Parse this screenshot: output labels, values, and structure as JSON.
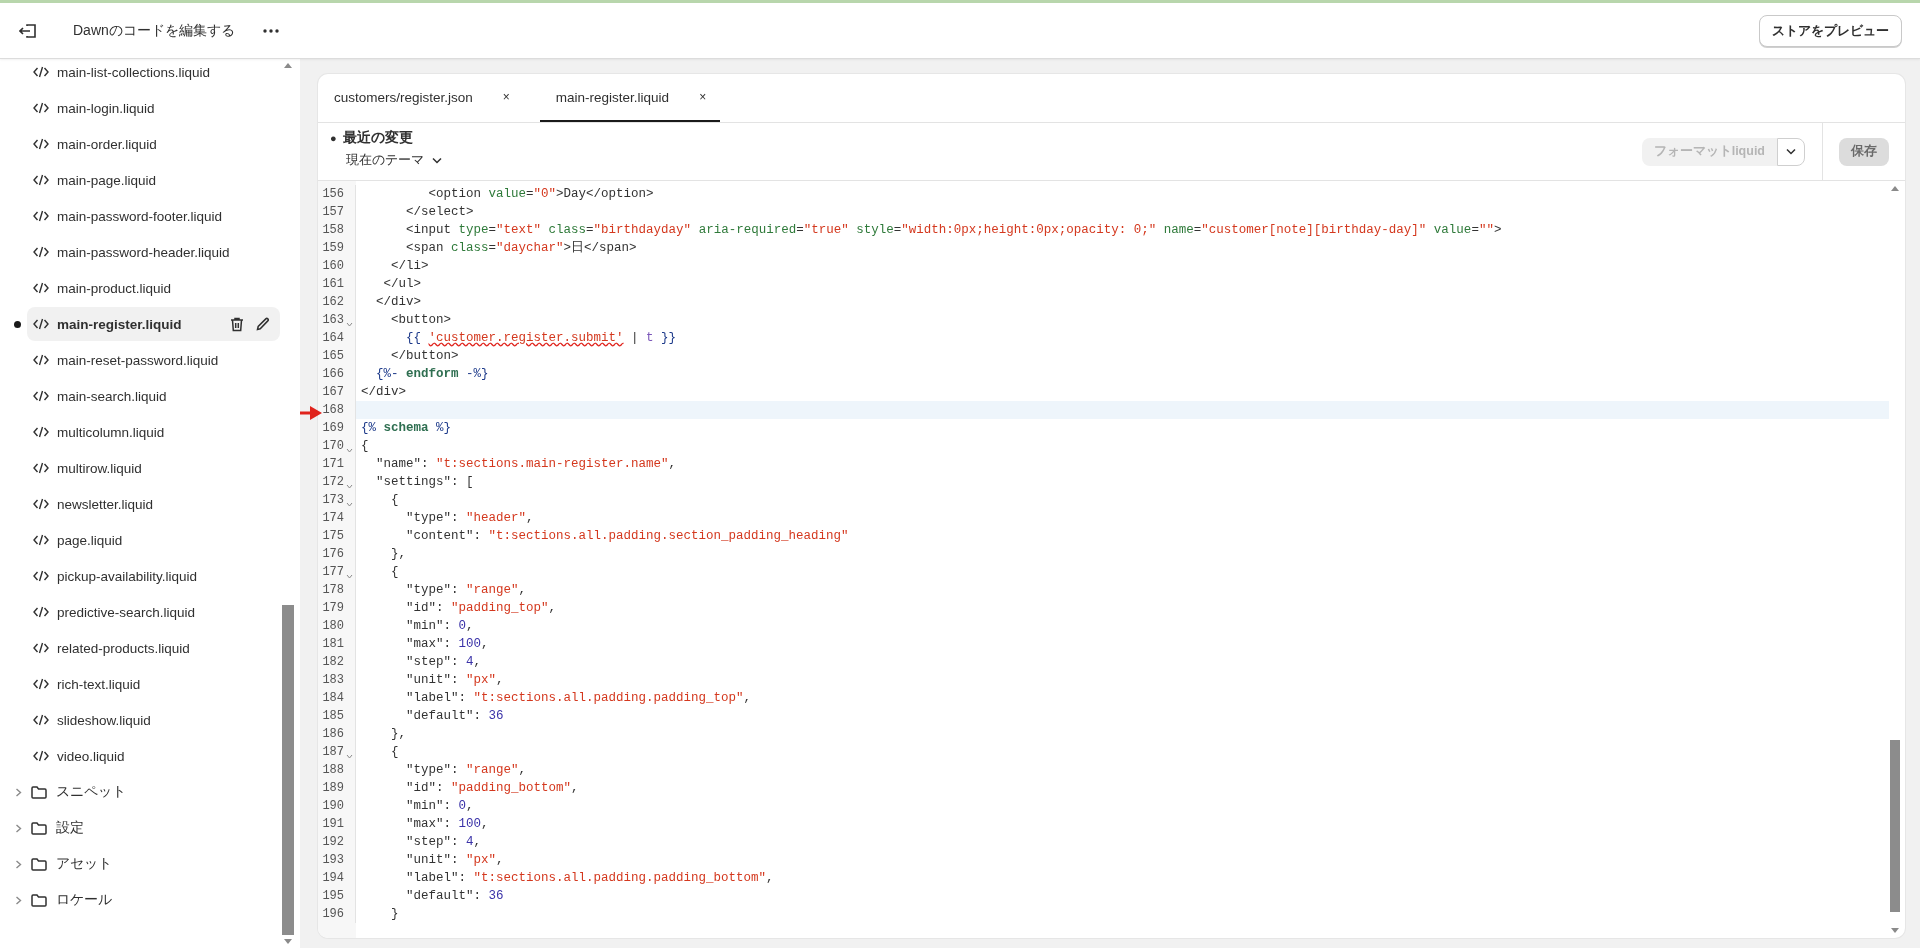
{
  "topbar": {
    "title": "Dawnのコードを編集する",
    "preview_button": "ストアをプレビュー"
  },
  "sidebar": {
    "files": [
      {
        "label": "main-list-collections.liquid",
        "selected": false,
        "modified": false
      },
      {
        "label": "main-login.liquid",
        "selected": false,
        "modified": false
      },
      {
        "label": "main-order.liquid",
        "selected": false,
        "modified": false
      },
      {
        "label": "main-page.liquid",
        "selected": false,
        "modified": false
      },
      {
        "label": "main-password-footer.liquid",
        "selected": false,
        "modified": false
      },
      {
        "label": "main-password-header.liquid",
        "selected": false,
        "modified": false
      },
      {
        "label": "main-product.liquid",
        "selected": false,
        "modified": false
      },
      {
        "label": "main-register.liquid",
        "selected": true,
        "modified": true
      },
      {
        "label": "main-reset-password.liquid",
        "selected": false,
        "modified": false
      },
      {
        "label": "main-search.liquid",
        "selected": false,
        "modified": false
      },
      {
        "label": "multicolumn.liquid",
        "selected": false,
        "modified": false
      },
      {
        "label": "multirow.liquid",
        "selected": false,
        "modified": false
      },
      {
        "label": "newsletter.liquid",
        "selected": false,
        "modified": false
      },
      {
        "label": "page.liquid",
        "selected": false,
        "modified": false
      },
      {
        "label": "pickup-availability.liquid",
        "selected": false,
        "modified": false
      },
      {
        "label": "predictive-search.liquid",
        "selected": false,
        "modified": false
      },
      {
        "label": "related-products.liquid",
        "selected": false,
        "modified": false
      },
      {
        "label": "rich-text.liquid",
        "selected": false,
        "modified": false
      },
      {
        "label": "slideshow.liquid",
        "selected": false,
        "modified": false
      },
      {
        "label": "video.liquid",
        "selected": false,
        "modified": false
      }
    ],
    "folders": [
      {
        "label": "スニペット",
        "expanded": false
      },
      {
        "label": "設定",
        "expanded": false
      },
      {
        "label": "アセット",
        "expanded": false
      },
      {
        "label": "ロケール",
        "expanded": false
      }
    ]
  },
  "editor": {
    "tabs": [
      {
        "label": "customers/register.json",
        "close": "×",
        "selected": false
      },
      {
        "label": "main-register.liquid",
        "close": "×",
        "selected": true
      }
    ],
    "recent_changes": {
      "dot": "●",
      "label": "最近の変更",
      "theme": "現在のテーマ"
    },
    "format_button": {
      "label": "フォーマットliquid",
      "disabled": true
    },
    "save_button": {
      "label": "保存",
      "disabled": true
    },
    "lines": [
      {
        "number": "156",
        "foldable": false,
        "current": false,
        "tokens": [
          {
            "kind": "plain",
            "text": "         <option "
          },
          {
            "kind": "attr",
            "text": "value"
          },
          {
            "kind": "plain",
            "text": "="
          },
          {
            "kind": "string",
            "text": "\"0\""
          },
          {
            "kind": "plain",
            "text": ">Day</option>"
          }
        ]
      },
      {
        "number": "157",
        "foldable": false,
        "current": false,
        "tokens": [
          {
            "kind": "plain",
            "text": "      </select>"
          }
        ]
      },
      {
        "number": "158",
        "foldable": false,
        "current": false,
        "tokens": [
          {
            "kind": "plain",
            "text": "      <input "
          },
          {
            "kind": "attr",
            "text": "type"
          },
          {
            "kind": "plain",
            "text": "="
          },
          {
            "kind": "string",
            "text": "\"text\""
          },
          {
            "kind": "attr",
            "text": " class"
          },
          {
            "kind": "plain",
            "text": "="
          },
          {
            "kind": "string",
            "text": "\"birthdayday\""
          },
          {
            "kind": "attr",
            "text": " aria-required"
          },
          {
            "kind": "plain",
            "text": "="
          },
          {
            "kind": "string",
            "text": "\"true\""
          },
          {
            "kind": "attr",
            "text": " style"
          },
          {
            "kind": "plain",
            "text": "="
          },
          {
            "kind": "string",
            "text": "\"width:0px;height:0px;opacity: 0;\""
          },
          {
            "kind": "attr",
            "text": " name"
          },
          {
            "kind": "plain",
            "text": "="
          },
          {
            "kind": "string",
            "text": "\"customer[note][birthday-day]\""
          },
          {
            "kind": "attr",
            "text": " value"
          },
          {
            "kind": "plain",
            "text": "="
          },
          {
            "kind": "string",
            "text": "\"\""
          },
          {
            "kind": "plain",
            "text": ">"
          }
        ]
      },
      {
        "number": "159",
        "foldable": false,
        "current": false,
        "tokens": [
          {
            "kind": "plain",
            "text": "      <span "
          },
          {
            "kind": "attr",
            "text": "class"
          },
          {
            "kind": "plain",
            "text": "="
          },
          {
            "kind": "string",
            "text": "\"daychar\""
          },
          {
            "kind": "plain",
            "text": ">日</span>"
          }
        ]
      },
      {
        "number": "160",
        "foldable": false,
        "current": false,
        "tokens": [
          {
            "kind": "plain",
            "text": "    </li>"
          }
        ]
      },
      {
        "number": "161",
        "foldable": false,
        "current": false,
        "tokens": [
          {
            "kind": "plain",
            "text": "   </ul>"
          }
        ]
      },
      {
        "number": "162",
        "foldable": false,
        "current": false,
        "tokens": [
          {
            "kind": "plain",
            "text": "  </div>"
          }
        ]
      },
      {
        "number": "163",
        "foldable": true,
        "current": false,
        "tokens": [
          {
            "kind": "plain",
            "text": "    <button>"
          }
        ]
      },
      {
        "number": "164",
        "foldable": false,
        "current": false,
        "tokens": [
          {
            "kind": "liquid",
            "text": "      {{ "
          },
          {
            "kind": "error",
            "text": "'customer.register.submit'"
          },
          {
            "kind": "plain",
            "text": " | "
          },
          {
            "kind": "filter",
            "text": "t"
          },
          {
            "kind": "liquid",
            "text": " }}"
          }
        ]
      },
      {
        "number": "165",
        "foldable": false,
        "current": false,
        "tokens": [
          {
            "kind": "plain",
            "text": "    </button>"
          }
        ]
      },
      {
        "number": "166",
        "foldable": false,
        "current": false,
        "tokens": [
          {
            "kind": "liquid",
            "text": "  {%- "
          },
          {
            "kind": "keyword",
            "text": "endform"
          },
          {
            "kind": "liquid",
            "text": " -%}"
          }
        ]
      },
      {
        "number": "167",
        "foldable": false,
        "current": false,
        "tokens": [
          {
            "kind": "plain",
            "text": "</div>"
          }
        ]
      },
      {
        "number": "168",
        "foldable": false,
        "current": true
      },
      {
        "number": "169",
        "foldable": false,
        "current": false,
        "tokens": [
          {
            "kind": "liquid",
            "text": "{% "
          },
          {
            "kind": "keyword",
            "text": "schema"
          },
          {
            "kind": "liquid",
            "text": " %}"
          }
        ]
      },
      {
        "number": "170",
        "foldable": true,
        "current": false,
        "tokens": [
          {
            "kind": "plain",
            "text": "{"
          }
        ]
      },
      {
        "number": "171",
        "foldable": false,
        "current": false,
        "tokens": [
          {
            "kind": "plain",
            "text": "  \"name\": "
          },
          {
            "kind": "string",
            "text": "\"t:sections.main-register.name\""
          },
          {
            "kind": "plain",
            "text": ","
          }
        ]
      },
      {
        "number": "172",
        "foldable": true,
        "current": false,
        "tokens": [
          {
            "kind": "plain",
            "text": "  \"settings\": ["
          }
        ]
      },
      {
        "number": "173",
        "foldable": true,
        "current": false,
        "tokens": [
          {
            "kind": "plain",
            "text": "    {"
          }
        ]
      },
      {
        "number": "174",
        "foldable": false,
        "current": false,
        "tokens": [
          {
            "kind": "plain",
            "text": "      \"type\": "
          },
          {
            "kind": "string",
            "text": "\"header\""
          },
          {
            "kind": "plain",
            "text": ","
          }
        ]
      },
      {
        "number": "175",
        "foldable": false,
        "current": false,
        "tokens": [
          {
            "kind": "plain",
            "text": "      \"content\": "
          },
          {
            "kind": "string",
            "text": "\"t:sections.all.padding.section_padding_heading\""
          }
        ]
      },
      {
        "number": "176",
        "foldable": false,
        "current": false,
        "tokens": [
          {
            "kind": "plain",
            "text": "    },"
          }
        ]
      },
      {
        "number": "177",
        "foldable": true,
        "current": false,
        "tokens": [
          {
            "kind": "plain",
            "text": "    {"
          }
        ]
      },
      {
        "number": "178",
        "foldable": false,
        "current": false,
        "tokens": [
          {
            "kind": "plain",
            "text": "      \"type\": "
          },
          {
            "kind": "string",
            "text": "\"range\""
          },
          {
            "kind": "plain",
            "text": ","
          }
        ]
      },
      {
        "number": "179",
        "foldable": false,
        "current": false,
        "tokens": [
          {
            "kind": "plain",
            "text": "      \"id\": "
          },
          {
            "kind": "string",
            "text": "\"padding_top\""
          },
          {
            "kind": "plain",
            "text": ","
          }
        ]
      },
      {
        "number": "180",
        "foldable": false,
        "current": false,
        "tokens": [
          {
            "kind": "plain",
            "text": "      \"min\": "
          },
          {
            "kind": "number",
            "text": "0"
          },
          {
            "kind": "plain",
            "text": ","
          }
        ]
      },
      {
        "number": "181",
        "foldable": false,
        "current": false,
        "tokens": [
          {
            "kind": "plain",
            "text": "      \"max\": "
          },
          {
            "kind": "number",
            "text": "100"
          },
          {
            "kind": "plain",
            "text": ","
          }
        ]
      },
      {
        "number": "182",
        "foldable": false,
        "current": false,
        "tokens": [
          {
            "kind": "plain",
            "text": "      \"step\": "
          },
          {
            "kind": "number",
            "text": "4"
          },
          {
            "kind": "plain",
            "text": ","
          }
        ]
      },
      {
        "number": "183",
        "foldable": false,
        "current": false,
        "tokens": [
          {
            "kind": "plain",
            "text": "      \"unit\": "
          },
          {
            "kind": "string",
            "text": "\"px\""
          },
          {
            "kind": "plain",
            "text": ","
          }
        ]
      },
      {
        "number": "184",
        "foldable": false,
        "current": false,
        "tokens": [
          {
            "kind": "plain",
            "text": "      \"label\": "
          },
          {
            "kind": "string",
            "text": "\"t:sections.all.padding.padding_top\""
          },
          {
            "kind": "plain",
            "text": ","
          }
        ]
      },
      {
        "number": "185",
        "foldable": false,
        "current": false,
        "tokens": [
          {
            "kind": "plain",
            "text": "      \"default\": "
          },
          {
            "kind": "number",
            "text": "36"
          }
        ]
      },
      {
        "number": "186",
        "foldable": false,
        "current": false,
        "tokens": [
          {
            "kind": "plain",
            "text": "    },"
          }
        ]
      },
      {
        "number": "187",
        "foldable": true,
        "current": false,
        "tokens": [
          {
            "kind": "plain",
            "text": "    {"
          }
        ]
      },
      {
        "number": "188",
        "foldable": false,
        "current": false,
        "tokens": [
          {
            "kind": "plain",
            "text": "      \"type\": "
          },
          {
            "kind": "string",
            "text": "\"range\""
          },
          {
            "kind": "plain",
            "text": ","
          }
        ]
      },
      {
        "number": "189",
        "foldable": false,
        "current": false,
        "tokens": [
          {
            "kind": "plain",
            "text": "      \"id\": "
          },
          {
            "kind": "string",
            "text": "\"padding_bottom\""
          },
          {
            "kind": "plain",
            "text": ","
          }
        ]
      },
      {
        "number": "190",
        "foldable": false,
        "current": false,
        "tokens": [
          {
            "kind": "plain",
            "text": "      \"min\": "
          },
          {
            "kind": "number",
            "text": "0"
          },
          {
            "kind": "plain",
            "text": ","
          }
        ]
      },
      {
        "number": "191",
        "foldable": false,
        "current": false,
        "tokens": [
          {
            "kind": "plain",
            "text": "      \"max\": "
          },
          {
            "kind": "number",
            "text": "100"
          },
          {
            "kind": "plain",
            "text": ","
          }
        ]
      },
      {
        "number": "192",
        "foldable": false,
        "current": false,
        "tokens": [
          {
            "kind": "plain",
            "text": "      \"step\": "
          },
          {
            "kind": "number",
            "text": "4"
          },
          {
            "kind": "plain",
            "text": ","
          }
        ]
      },
      {
        "number": "193",
        "foldable": false,
        "current": false,
        "tokens": [
          {
            "kind": "plain",
            "text": "      \"unit\": "
          },
          {
            "kind": "string",
            "text": "\"px\""
          },
          {
            "kind": "plain",
            "text": ","
          }
        ]
      },
      {
        "number": "194",
        "foldable": false,
        "current": false,
        "tokens": [
          {
            "kind": "plain",
            "text": "      \"label\": "
          },
          {
            "kind": "string",
            "text": "\"t:sections.all.padding.padding_bottom\""
          },
          {
            "kind": "plain",
            "text": ","
          }
        ]
      },
      {
        "number": "195",
        "foldable": false,
        "current": false,
        "tokens": [
          {
            "kind": "plain",
            "text": "      \"default\": "
          },
          {
            "kind": "number",
            "text": "36"
          }
        ]
      },
      {
        "number": "196",
        "foldable": false,
        "current": false,
        "tokens": [
          {
            "kind": "plain",
            "text": "    }"
          }
        ]
      }
    ]
  }
}
